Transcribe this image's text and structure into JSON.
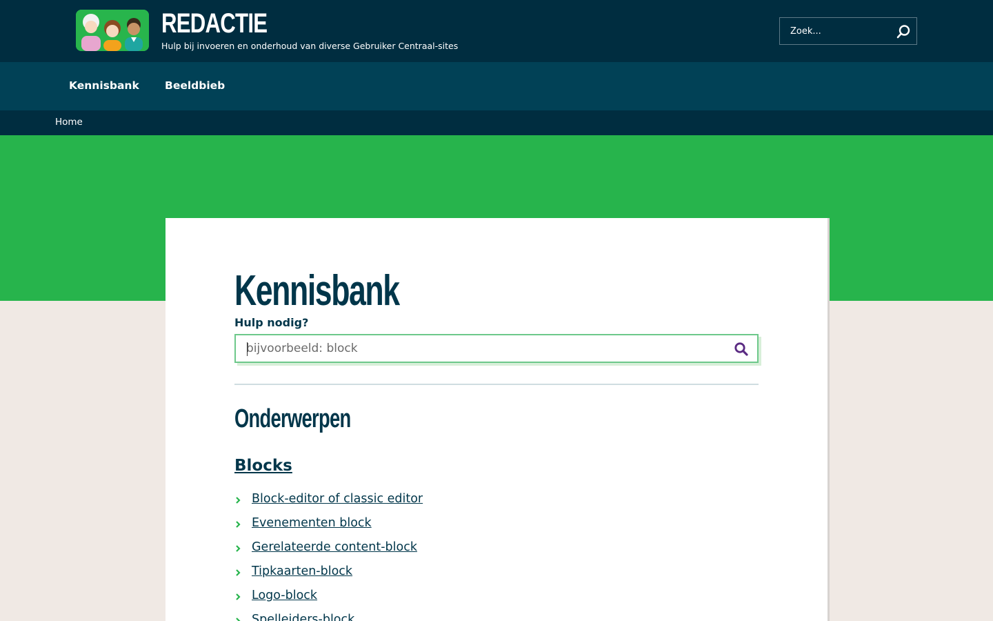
{
  "header": {
    "title": "REDACTIE",
    "tagline": "Hulp bij invoeren en onderhoud van diverse Gebruiker Centraal-sites",
    "search_placeholder": "Zoek...",
    "search_icon": "search-icon"
  },
  "nav": {
    "items": [
      {
        "label": "Kennisbank"
      },
      {
        "label": "Beeldbieb"
      }
    ]
  },
  "breadcrumb": {
    "home": "Home"
  },
  "main": {
    "title": "Kennisbank",
    "help_label": "Hulp nodig?",
    "search_placeholder": "bijvoorbeeld: block",
    "section_title": "Onderwerpen",
    "category": "Blocks",
    "topics": [
      "Block-editor of classic editor",
      "Evenementen block",
      "Gerelateerde content-block",
      "Tipkaarten-block",
      "Logo-block",
      "Spelleiders-block"
    ]
  },
  "colors": {
    "header_bg": "#002d40",
    "nav_bg": "#014156",
    "banner_green": "#27b44c",
    "page_bg": "#f0e9e4",
    "text_dark": "#01364a",
    "search_icon_purple": "#5a2a82"
  }
}
